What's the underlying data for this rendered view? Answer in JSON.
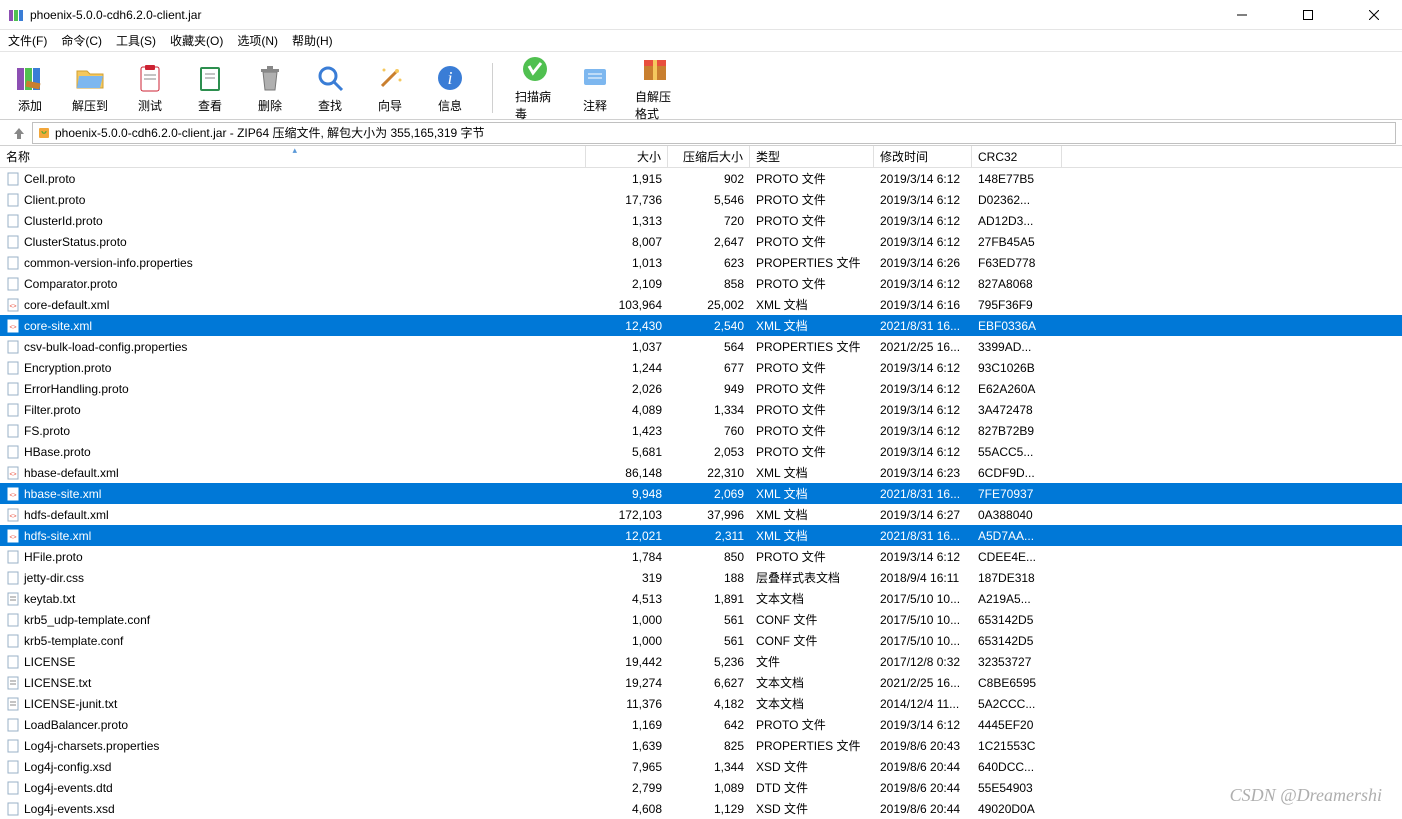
{
  "title": "phoenix-5.0.0-cdh6.2.0-client.jar",
  "menus": [
    "文件(F)",
    "命令(C)",
    "工具(S)",
    "收藏夹(O)",
    "选项(N)",
    "帮助(H)"
  ],
  "toolbar": [
    {
      "label": "添加",
      "icon": "books"
    },
    {
      "label": "解压到",
      "icon": "folder"
    },
    {
      "label": "测试",
      "icon": "clipboard"
    },
    {
      "label": "查看",
      "icon": "book"
    },
    {
      "label": "删除",
      "icon": "trash"
    },
    {
      "label": "查找",
      "icon": "search"
    },
    {
      "label": "向导",
      "icon": "wand"
    },
    {
      "label": "信息",
      "icon": "info"
    }
  ],
  "toolbar2": [
    {
      "label": "扫描病毒",
      "icon": "shield"
    },
    {
      "label": "注释",
      "icon": "comment"
    },
    {
      "label": "自解压格式",
      "icon": "box"
    }
  ],
  "path": "phoenix-5.0.0-cdh6.2.0-client.jar - ZIP64 压缩文件, 解包大小为 355,165,319 字节",
  "columns": {
    "name": "名称",
    "size": "大小",
    "packed": "压缩后大小",
    "type": "类型",
    "date": "修改时间",
    "crc": "CRC32"
  },
  "files": [
    {
      "n": "Cell.proto",
      "s": "1,915",
      "p": "902",
      "t": "PROTO 文件",
      "d": "2019/3/14 6:12",
      "c": "148E77B5",
      "i": "file"
    },
    {
      "n": "Client.proto",
      "s": "17,736",
      "p": "5,546",
      "t": "PROTO 文件",
      "d": "2019/3/14 6:12",
      "c": "D02362...",
      "i": "file"
    },
    {
      "n": "ClusterId.proto",
      "s": "1,313",
      "p": "720",
      "t": "PROTO 文件",
      "d": "2019/3/14 6:12",
      "c": "AD12D3...",
      "i": "file"
    },
    {
      "n": "ClusterStatus.proto",
      "s": "8,007",
      "p": "2,647",
      "t": "PROTO 文件",
      "d": "2019/3/14 6:12",
      "c": "27FB45A5",
      "i": "file"
    },
    {
      "n": "common-version-info.properties",
      "s": "1,013",
      "p": "623",
      "t": "PROPERTIES 文件",
      "d": "2019/3/14 6:26",
      "c": "F63ED778",
      "i": "file"
    },
    {
      "n": "Comparator.proto",
      "s": "2,109",
      "p": "858",
      "t": "PROTO 文件",
      "d": "2019/3/14 6:12",
      "c": "827A8068",
      "i": "file"
    },
    {
      "n": "core-default.xml",
      "s": "103,964",
      "p": "25,002",
      "t": "XML 文档",
      "d": "2019/3/14 6:16",
      "c": "795F36F9",
      "i": "xml"
    },
    {
      "n": "core-site.xml",
      "s": "12,430",
      "p": "2,540",
      "t": "XML 文档",
      "d": "2021/8/31 16...",
      "c": "EBF0336A",
      "i": "xml",
      "sel": true
    },
    {
      "n": "csv-bulk-load-config.properties",
      "s": "1,037",
      "p": "564",
      "t": "PROPERTIES 文件",
      "d": "2021/2/25 16...",
      "c": "3399AD...",
      "i": "file"
    },
    {
      "n": "Encryption.proto",
      "s": "1,244",
      "p": "677",
      "t": "PROTO 文件",
      "d": "2019/3/14 6:12",
      "c": "93C1026B",
      "i": "file"
    },
    {
      "n": "ErrorHandling.proto",
      "s": "2,026",
      "p": "949",
      "t": "PROTO 文件",
      "d": "2019/3/14 6:12",
      "c": "E62A260A",
      "i": "file"
    },
    {
      "n": "Filter.proto",
      "s": "4,089",
      "p": "1,334",
      "t": "PROTO 文件",
      "d": "2019/3/14 6:12",
      "c": "3A472478",
      "i": "file"
    },
    {
      "n": "FS.proto",
      "s": "1,423",
      "p": "760",
      "t": "PROTO 文件",
      "d": "2019/3/14 6:12",
      "c": "827B72B9",
      "i": "file"
    },
    {
      "n": "HBase.proto",
      "s": "5,681",
      "p": "2,053",
      "t": "PROTO 文件",
      "d": "2019/3/14 6:12",
      "c": "55ACC5...",
      "i": "file"
    },
    {
      "n": "hbase-default.xml",
      "s": "86,148",
      "p": "22,310",
      "t": "XML 文档",
      "d": "2019/3/14 6:23",
      "c": "6CDF9D...",
      "i": "xml"
    },
    {
      "n": "hbase-site.xml",
      "s": "9,948",
      "p": "2,069",
      "t": "XML 文档",
      "d": "2021/8/31 16...",
      "c": "7FE70937",
      "i": "xml",
      "sel": true
    },
    {
      "n": "hdfs-default.xml",
      "s": "172,103",
      "p": "37,996",
      "t": "XML 文档",
      "d": "2019/3/14 6:27",
      "c": "0A388040",
      "i": "xml"
    },
    {
      "n": "hdfs-site.xml",
      "s": "12,021",
      "p": "2,311",
      "t": "XML 文档",
      "d": "2021/8/31 16...",
      "c": "A5D7AA...",
      "i": "xml",
      "sel": true
    },
    {
      "n": "HFile.proto",
      "s": "1,784",
      "p": "850",
      "t": "PROTO 文件",
      "d": "2019/3/14 6:12",
      "c": "CDEE4E...",
      "i": "file"
    },
    {
      "n": "jetty-dir.css",
      "s": "319",
      "p": "188",
      "t": "层叠样式表文档",
      "d": "2018/9/4 16:11",
      "c": "187DE318",
      "i": "file"
    },
    {
      "n": "keytab.txt",
      "s": "4,513",
      "p": "1,891",
      "t": "文本文档",
      "d": "2017/5/10 10...",
      "c": "A219A5...",
      "i": "txt"
    },
    {
      "n": "krb5_udp-template.conf",
      "s": "1,000",
      "p": "561",
      "t": "CONF 文件",
      "d": "2017/5/10 10...",
      "c": "653142D5",
      "i": "file"
    },
    {
      "n": "krb5-template.conf",
      "s": "1,000",
      "p": "561",
      "t": "CONF 文件",
      "d": "2017/5/10 10...",
      "c": "653142D5",
      "i": "file"
    },
    {
      "n": "LICENSE",
      "s": "19,442",
      "p": "5,236",
      "t": "文件",
      "d": "2017/12/8 0:32",
      "c": "32353727",
      "i": "file"
    },
    {
      "n": "LICENSE.txt",
      "s": "19,274",
      "p": "6,627",
      "t": "文本文档",
      "d": "2021/2/25 16...",
      "c": "C8BE6595",
      "i": "txt"
    },
    {
      "n": "LICENSE-junit.txt",
      "s": "11,376",
      "p": "4,182",
      "t": "文本文档",
      "d": "2014/12/4 11...",
      "c": "5A2CCC...",
      "i": "txt"
    },
    {
      "n": "LoadBalancer.proto",
      "s": "1,169",
      "p": "642",
      "t": "PROTO 文件",
      "d": "2019/3/14 6:12",
      "c": "4445EF20",
      "i": "file"
    },
    {
      "n": "Log4j-charsets.properties",
      "s": "1,639",
      "p": "825",
      "t": "PROPERTIES 文件",
      "d": "2019/8/6 20:43",
      "c": "1C21553C",
      "i": "file"
    },
    {
      "n": "Log4j-config.xsd",
      "s": "7,965",
      "p": "1,344",
      "t": "XSD 文件",
      "d": "2019/8/6 20:44",
      "c": "640DCC...",
      "i": "file"
    },
    {
      "n": "Log4j-events.dtd",
      "s": "2,799",
      "p": "1,089",
      "t": "DTD 文件",
      "d": "2019/8/6 20:44",
      "c": "55E54903",
      "i": "file"
    },
    {
      "n": "Log4j-events.xsd",
      "s": "4,608",
      "p": "1,129",
      "t": "XSD 文件",
      "d": "2019/8/6 20:44",
      "c": "49020D0A",
      "i": "file"
    }
  ],
  "watermark": "CSDN @Dreamershi"
}
